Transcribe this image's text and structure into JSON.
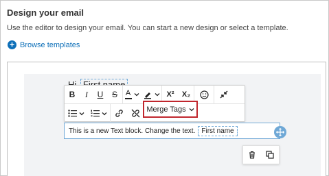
{
  "header": {
    "title": "Design your email",
    "subtitle": "Use the editor to design your email. You can start a new design or select a template."
  },
  "browse": {
    "label": "Browse templates"
  },
  "editor": {
    "heading_text": "Hi",
    "heading_tag": "First name",
    "toolbar": {
      "bold": "B",
      "italic": "I",
      "underline": "U",
      "strikethrough": "S",
      "font_color": "A",
      "superscript": "X²",
      "subscript": "X₂",
      "merge_tags_label": "Merge Tags"
    },
    "text_block": {
      "text": "This is a new Text block. Change the text.",
      "tag": "First name"
    }
  },
  "colors": {
    "accent": "#0d6fb8",
    "highlight": "#c0262d",
    "selection": "#6fa8d6"
  }
}
